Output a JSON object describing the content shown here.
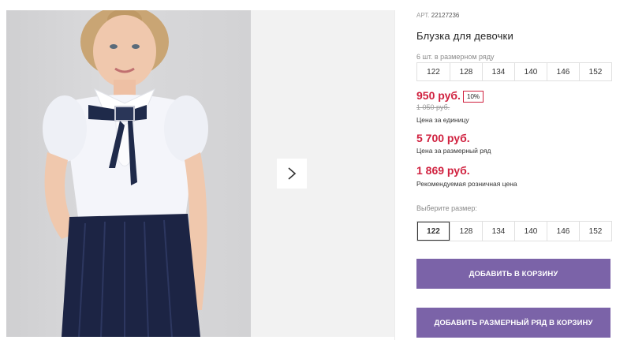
{
  "gallery": {
    "photo_alt": "Блузка для девочки",
    "next_icon": "chevron-right-icon"
  },
  "product": {
    "art_label": "АРТ.",
    "art_value": "22127236",
    "title": "Блузка для девочки",
    "pack_label": "6 шт. в размерном ряду",
    "pack_sizes": [
      "122",
      "128",
      "134",
      "140",
      "146",
      "152"
    ]
  },
  "pricing": {
    "unit_price": "950 руб.",
    "discount": "10%",
    "old_price": "1 050 руб.",
    "unit_caption": "Цена за единицу",
    "pack_price": "5 700 руб.",
    "pack_caption": "Цена за размерный ряд",
    "retail_price": "1 869 руб.",
    "retail_caption": "Рекомендуемая розничная цена",
    "accent_color": "#d0213f"
  },
  "size_picker": {
    "label": "Выберите размер:",
    "sizes": [
      "122",
      "128",
      "134",
      "140",
      "146",
      "152"
    ],
    "selected": "122"
  },
  "actions": {
    "add_to_cart": "ДОБАВИТЬ В КОРЗИНУ",
    "add_pack_to_cart": "ДОБАВИТЬ РАЗМЕРНЫЙ РЯД В КОРЗИНУ",
    "button_color": "#7b63a8"
  }
}
